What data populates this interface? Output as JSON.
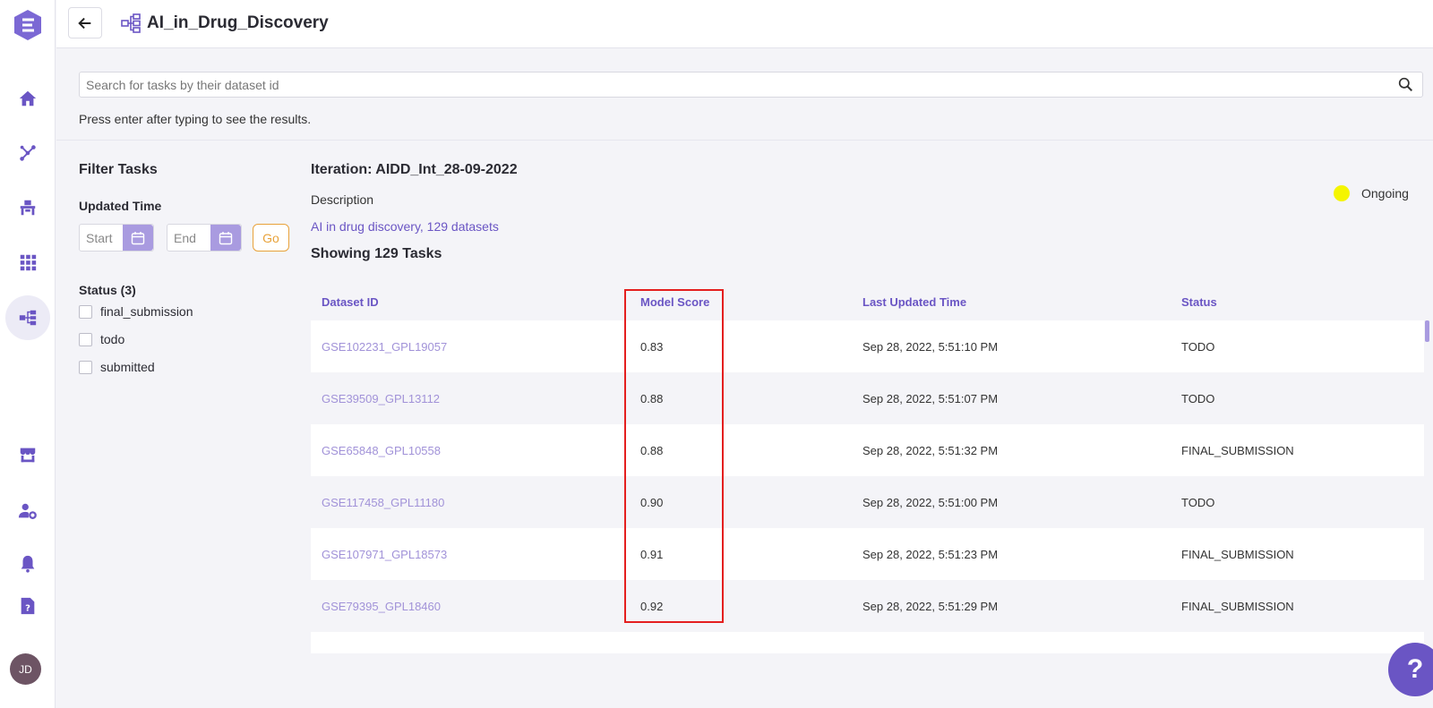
{
  "header": {
    "title": "AI_in_Drug_Discovery"
  },
  "search": {
    "placeholder": "Search for tasks by their dataset id",
    "hint": "Press enter after typing to see the results."
  },
  "filters": {
    "title": "Filter Tasks",
    "updated_time_label": "Updated Time",
    "start_placeholder": "Start",
    "end_placeholder": "End",
    "go_label": "Go",
    "status_label": "Status (3)",
    "statuses": [
      "final_submission",
      "todo",
      "submitted"
    ]
  },
  "iteration": {
    "title": "Iteration: AIDD_Int_28-09-2022",
    "description_label": "Description",
    "description": "AI in drug discovery, 129 datasets",
    "showing": "Showing 129 Tasks",
    "state": "Ongoing",
    "state_color": "#f5f500"
  },
  "table": {
    "columns": [
      "Dataset ID",
      "Model Score",
      "Last Updated Time",
      "Status"
    ],
    "rows": [
      {
        "dataset_id": "GSE102231_GPL19057",
        "score": "0.83",
        "updated": "Sep 28, 2022, 5:51:10 PM",
        "status": "TODO"
      },
      {
        "dataset_id": "GSE39509_GPL13112",
        "score": "0.88",
        "updated": "Sep 28, 2022, 5:51:07 PM",
        "status": "TODO"
      },
      {
        "dataset_id": "GSE65848_GPL10558",
        "score": "0.88",
        "updated": "Sep 28, 2022, 5:51:32 PM",
        "status": "FINAL_SUBMISSION"
      },
      {
        "dataset_id": "GSE117458_GPL11180",
        "score": "0.90",
        "updated": "Sep 28, 2022, 5:51:00 PM",
        "status": "TODO"
      },
      {
        "dataset_id": "GSE107971_GPL18573",
        "score": "0.91",
        "updated": "Sep 28, 2022, 5:51:23 PM",
        "status": "FINAL_SUBMISSION"
      },
      {
        "dataset_id": "GSE79395_GPL18460",
        "score": "0.92",
        "updated": "Sep 28, 2022, 5:51:29 PM",
        "status": "FINAL_SUBMISSION"
      }
    ]
  },
  "user": {
    "initials": "JD"
  },
  "help": {
    "label": "?"
  },
  "colors": {
    "accent": "#6a55c4",
    "highlight": "#e41f1f",
    "go": "#e8a23a"
  }
}
